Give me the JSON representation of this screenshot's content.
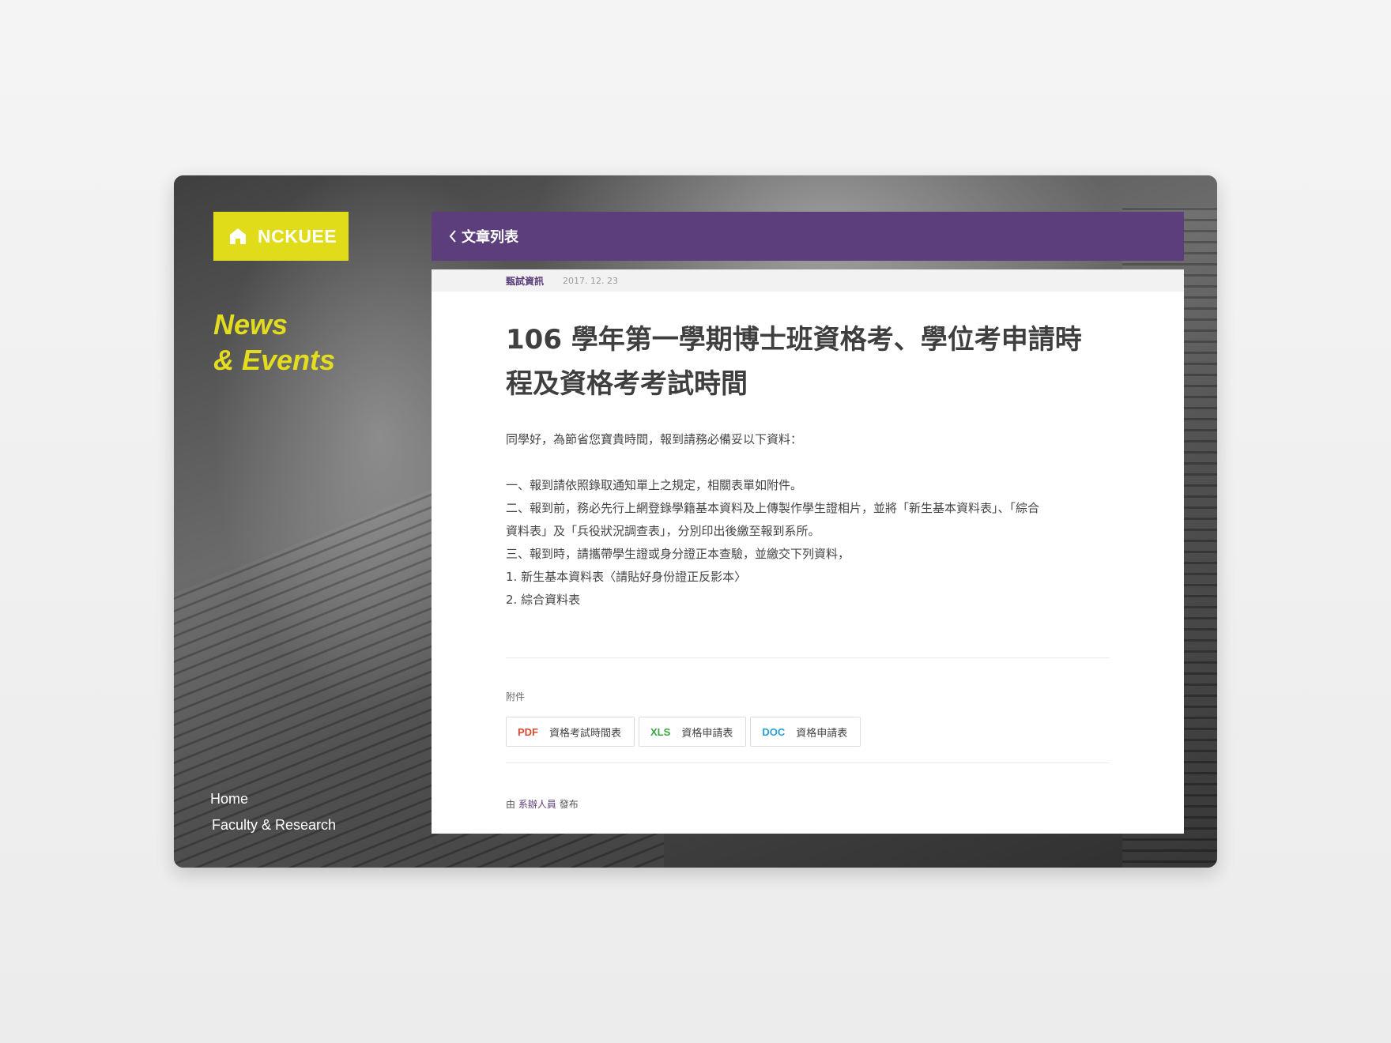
{
  "brand": {
    "logo_text": "NCKUEE",
    "accent_color": "#e1dc19",
    "home_icon": "home-icon"
  },
  "section": {
    "title_line1": "News",
    "title_line2": "& Events"
  },
  "side_nav": {
    "items": [
      {
        "label": "Home"
      },
      {
        "label": "Faculty & Research"
      }
    ]
  },
  "header": {
    "back_label": "文章列表",
    "back_icon": "chevron-left-icon",
    "bar_color": "#5b3e7b"
  },
  "article": {
    "category": "甄試資訊",
    "date": "2017. 12. 23",
    "title_line1": "106 學年第一學期博士班資格考、學位考申請時",
    "title_line2": "程及資格考考試時間",
    "intro": "同學好，為節省您寶貴時間，報到請務必備妥以下資料：",
    "lines": [
      "一、報到請依照錄取通知單上之規定，相關表單如附件。",
      "二、報到前，務必先行上網登錄學籍基本資料及上傳製作學生證相片，並將「新生基本資料表」、「綜合",
      "資料表」及「兵役狀況調查表」，分別印出後繳至報到系所。",
      "三、報到時，請攜帶學生證或身分證正本查驗，並繳交下列資料，",
      "1. 新生基本資料表〈請貼好身份證正反影本〉",
      "2. 綜合資料表"
    ]
  },
  "attachments": {
    "label": "附件",
    "items": [
      {
        "type": "PDF",
        "name": "資格考試時間表",
        "color": "#d64a34"
      },
      {
        "type": "XLS",
        "name": "資格申請表",
        "color": "#3aa545"
      },
      {
        "type": "DOC",
        "name": "資格申請表",
        "color": "#2a9ed8"
      }
    ]
  },
  "author": {
    "prefix": "由",
    "name": "系辦人員",
    "suffix": "發布"
  }
}
